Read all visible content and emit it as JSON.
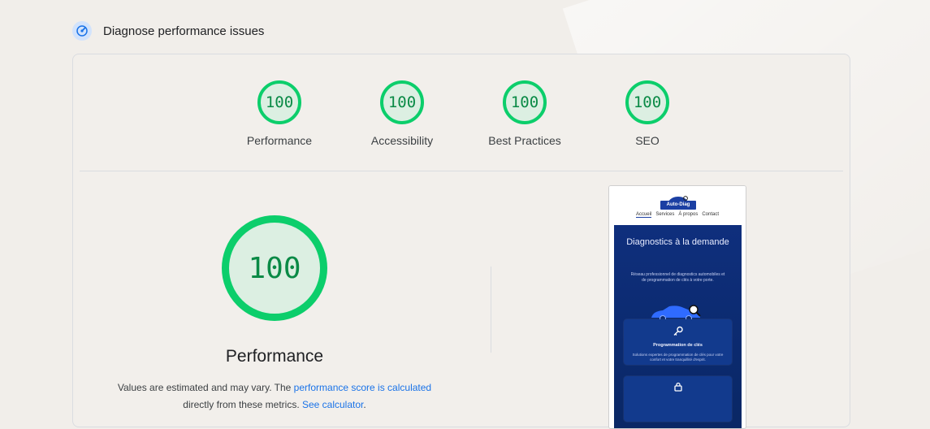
{
  "header": {
    "title": "Diagnose performance issues",
    "icon": "diagnostics-icon"
  },
  "categories": [
    {
      "label": "Performance",
      "score": "100"
    },
    {
      "label": "Accessibility",
      "score": "100"
    },
    {
      "label": "Best Practices",
      "score": "100"
    },
    {
      "label": "SEO",
      "score": "100"
    }
  ],
  "main": {
    "score": "100",
    "label": "Performance",
    "note_prefix": "Values are estimated and may vary. The ",
    "note_link": "performance score is calculated",
    "note_mid": " directly from these metrics. ",
    "note_calc": "See calculator",
    "note_end": "."
  },
  "screenshot": {
    "logo_text": "Auto-Diag",
    "nav": [
      "Accueil",
      "Services",
      "À propos",
      "Contact"
    ],
    "hero_title": "Diagnostics à la demande",
    "hero_subtitle": "Réseau professionnel de diagnostics automobiles et de programmation de clés à votre porte.",
    "service_1_title": "Programmation de clés",
    "service_1_desc": "Solutions expertes de programmation de clés pour votre confort et votre tranquillité d'esprit."
  },
  "colors": {
    "pass": "#0cce6b",
    "pass_text": "#0a8a46",
    "link": "#1a73e8"
  }
}
